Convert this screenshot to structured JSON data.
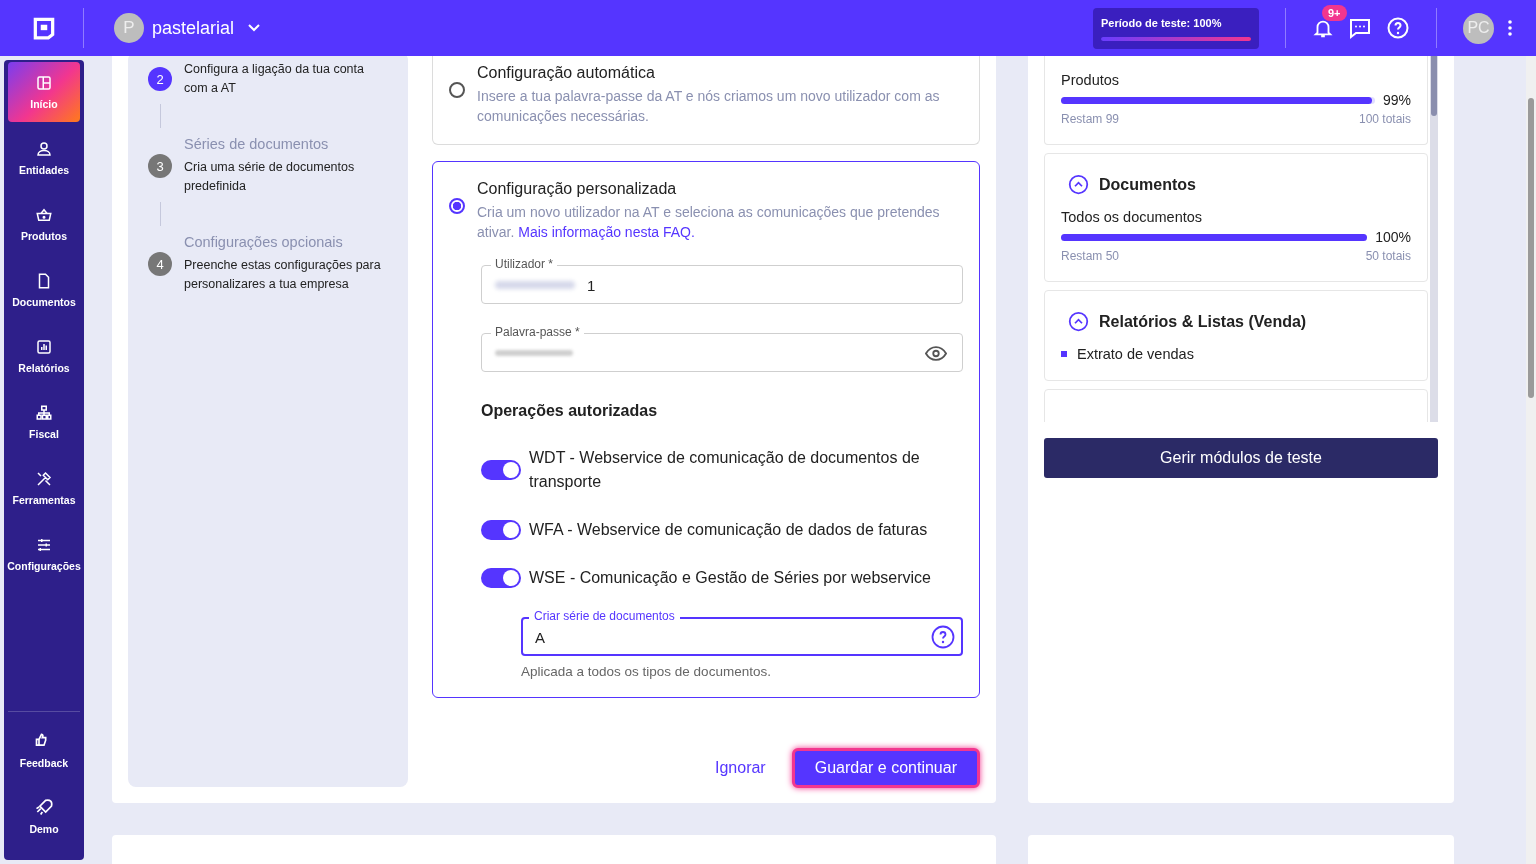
{
  "header": {
    "company_initial": "P",
    "company": "pastelarial",
    "trial": {
      "label": "Período de teste: 100%",
      "level": 1
    },
    "notifications_badge": "9+",
    "user_initials": "PC"
  },
  "sidebar": {
    "items": [
      {
        "label": "Início",
        "selected": true
      },
      {
        "label": "Entidades",
        "selected": false
      },
      {
        "label": "Produtos",
        "selected": false
      },
      {
        "label": "Documentos",
        "selected": false
      },
      {
        "label": "Relatórios",
        "selected": false
      },
      {
        "label": "Fiscal",
        "selected": false
      },
      {
        "label": "Ferramentas",
        "selected": false
      },
      {
        "label": "Configurações",
        "selected": false
      }
    ],
    "footer_items": [
      {
        "label": "Feedback"
      },
      {
        "label": "Demo"
      }
    ]
  },
  "stepper": {
    "steps": [
      {
        "number": "2",
        "description": "Configura a ligação da tua conta com a AT",
        "active": true
      },
      {
        "number": "3",
        "title": "Séries de documentos",
        "description": "Cria uma série de documentos predefinida",
        "active": false
      },
      {
        "number": "4",
        "title": "Configurações opcionais",
        "description": "Preenche estas configurações para personalizares a tua empresa",
        "active": false
      }
    ]
  },
  "options": [
    {
      "title": "Configuração automática",
      "description": "Insere a tua palavra-passe da AT e nós criamos um novo utilizador com as comunicações necessárias.",
      "selected": false
    },
    {
      "title": "Configuração personalizada",
      "description": "Cria um novo utilizador na AT e seleciona as comunicações que pretendes ativar.",
      "link": "Mais informação nesta FAQ.",
      "selected": true
    }
  ],
  "user_field": {
    "label": "Utilizador *",
    "value": "1"
  },
  "password_field": {
    "label": "Palavra-passe *"
  },
  "operations": {
    "title": "Operações autorizadas",
    "toggles": [
      {
        "label": "WDT - Webservice de comunicação de documentos de transporte",
        "on": true
      },
      {
        "label": "WFA - Webservice de comunicação de dados de faturas",
        "on": true
      },
      {
        "label": "WSE - Comunicação e Gestão de Séries por webservice",
        "on": true
      }
    ]
  },
  "series_field": {
    "label": "Criar série de documentos",
    "value": "A",
    "helper": "Aplicada a todos os tipos de documentos."
  },
  "actions": {
    "secondary": "Ignorar",
    "primary": "Guardar e continuar"
  },
  "modules": [
    {
      "usage": [
        {
          "name": "Produtos",
          "percent": "99%",
          "level": 0.99,
          "remaining": "Restam 99",
          "total": "100 totais"
        }
      ]
    },
    {
      "title": "Documentos",
      "expanded": true,
      "usage": [
        {
          "name": "Todos os documentos",
          "percent": "100%",
          "level": 1,
          "remaining": "Restam 50",
          "total": "50 totais"
        }
      ]
    },
    {
      "title": "Relatórios & Listas (Venda)",
      "expanded": true,
      "list": [
        "Extrato de vendas"
      ]
    }
  ],
  "manage_button": "Gerir módulos de teste"
}
